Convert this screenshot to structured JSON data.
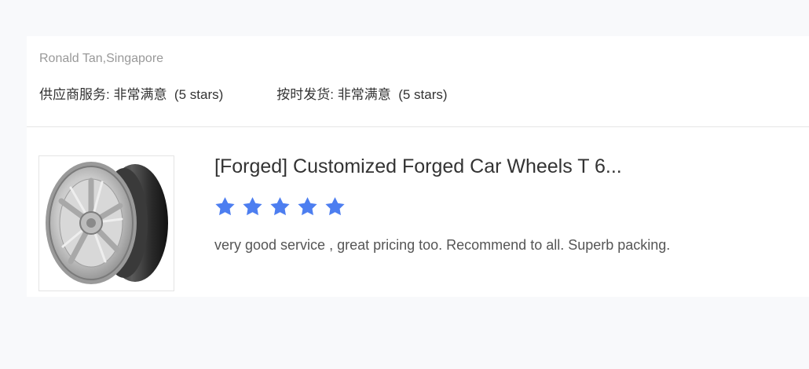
{
  "review": {
    "reviewer": "Ronald Tan,Singapore",
    "ratings": [
      {
        "label": "供应商服务:",
        "value": "非常满意",
        "stars_text": "(5 stars)"
      },
      {
        "label": "按时发货:",
        "value": "非常满意",
        "stars_text": "(5 stars)"
      }
    ],
    "product": {
      "image_icon": "forged-car-wheel",
      "title": "[Forged] Customized Forged Car Wheels T 6...",
      "rating": 5,
      "rating_max": 5,
      "star_color": "#4d7ef0",
      "comment": "very good service , great pricing too. Recommend to all. Superb packing."
    }
  }
}
